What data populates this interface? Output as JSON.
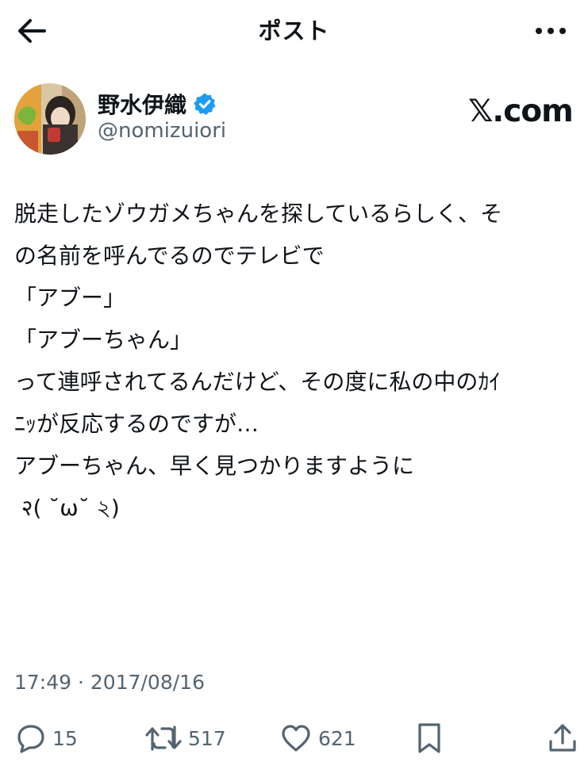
{
  "header": {
    "title": "ポスト",
    "back_icon": "arrow-left-icon",
    "more_icon": "more-horizontal-icon"
  },
  "author": {
    "name": "野水伊織",
    "handle": "@nomizuiori",
    "verified": true,
    "badge_color": "#1d9bf0"
  },
  "watermark": "𝕏.com",
  "post": {
    "lines": [
      "脱走したゾウガメちゃんを探しているらしく、そ",
      "の名前を呼んでるのでテレビで",
      "",
      "「アブー」",
      "「アブーちゃん」",
      "",
      "って連呼されてるんだけど、その度に私の中のｶｲ",
      "ﾆｯが反応するのですが…",
      "",
      "アブーちゃん、早く見つかりますように",
      " २( ˘ω˘ ২)"
    ],
    "timestamp": "17:49 · 2017/08/16"
  },
  "actions": {
    "reply": {
      "icon": "reply-icon",
      "count": "15"
    },
    "repost": {
      "icon": "repost-icon",
      "count": "517"
    },
    "like": {
      "icon": "heart-icon",
      "count": "621"
    },
    "bookmark": {
      "icon": "bookmark-icon"
    },
    "share": {
      "icon": "share-icon"
    }
  },
  "colors": {
    "text": "#0f1419",
    "secondary": "#536471",
    "accent": "#1d9bf0"
  }
}
